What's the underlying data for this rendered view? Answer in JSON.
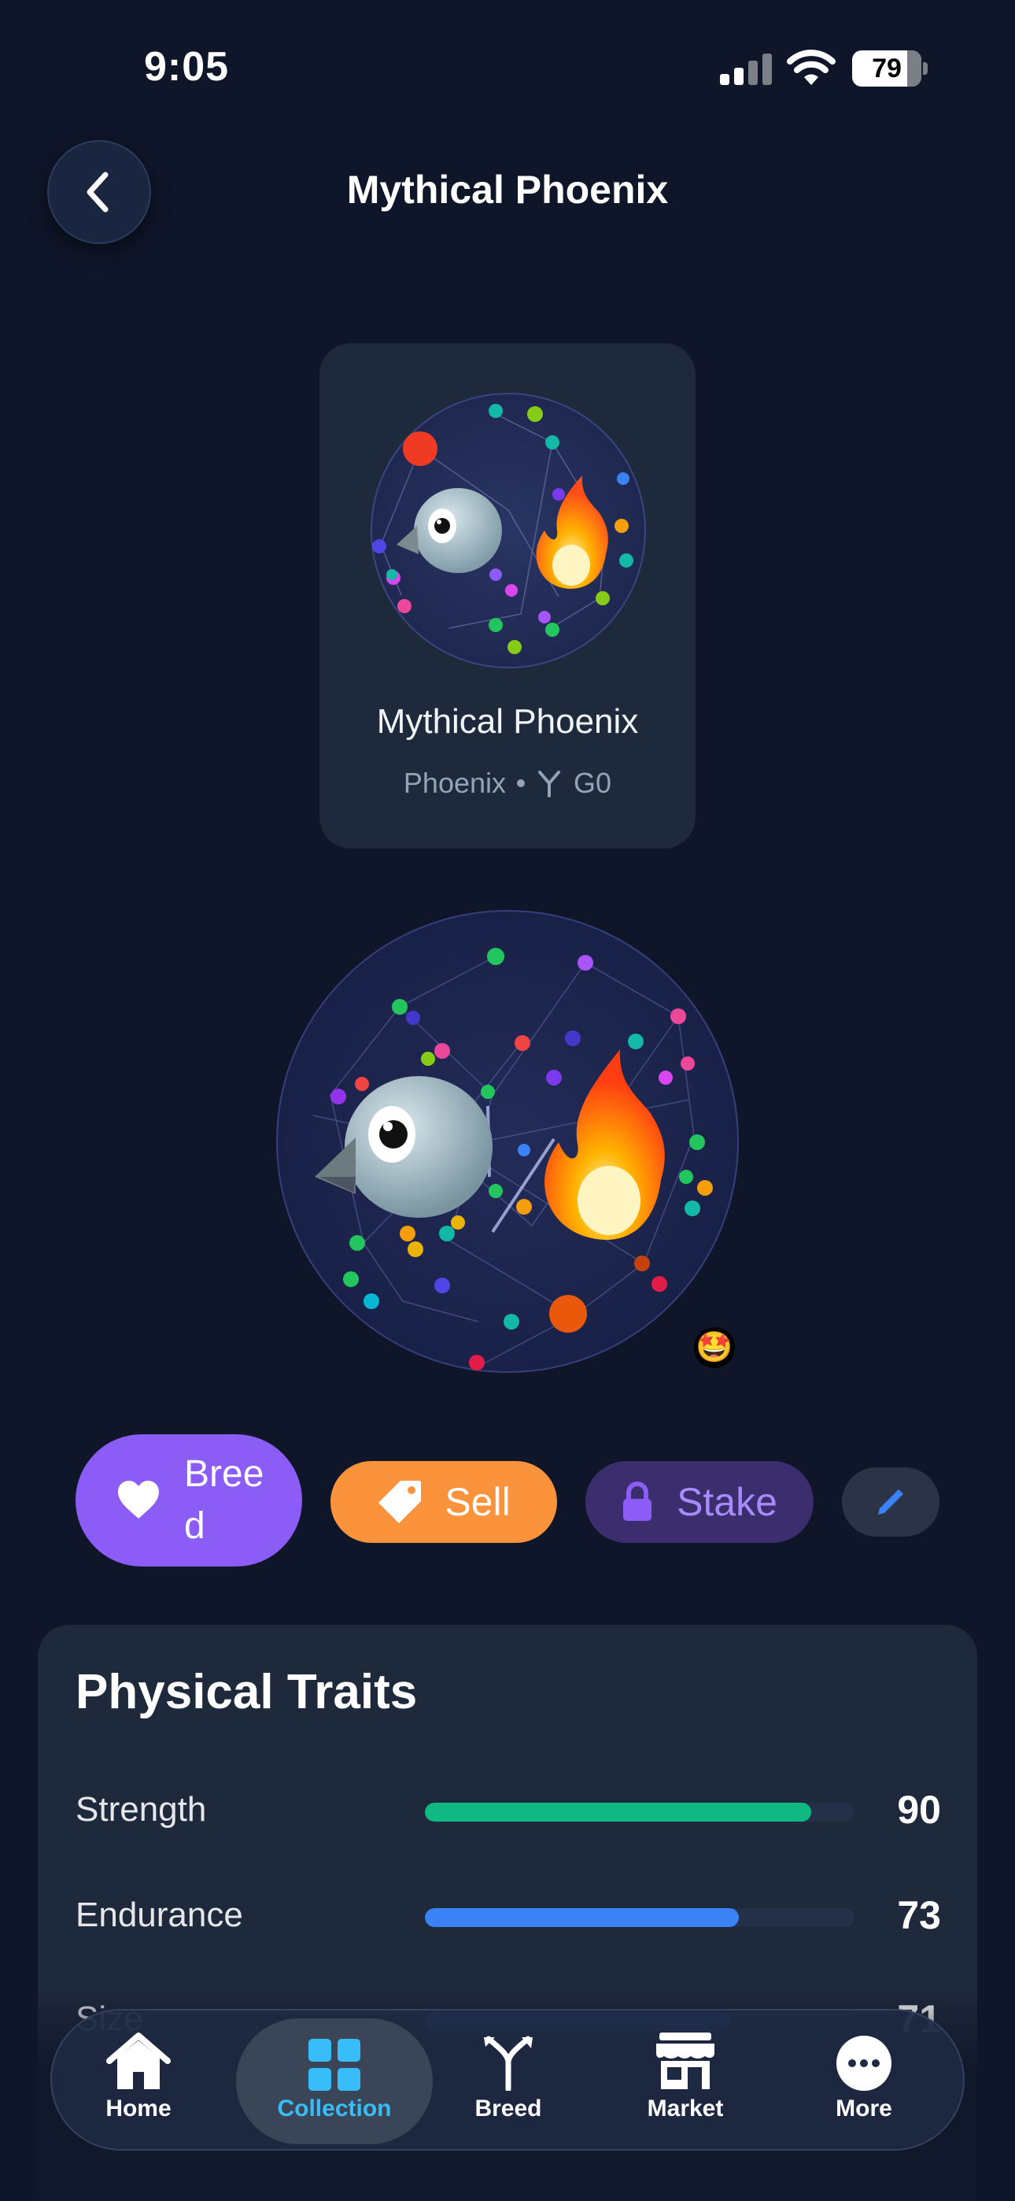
{
  "status_bar": {
    "time": "9:05",
    "battery": "79"
  },
  "header": {
    "title": "Mythical Phoenix"
  },
  "card": {
    "name": "Mythical Phoenix",
    "species": "Phoenix",
    "generation": "G0"
  },
  "mood_emoji": "🤩",
  "actions": {
    "breed": "Breed",
    "sell": "Sell",
    "stake": "Stake"
  },
  "traits": {
    "title": "Physical Traits",
    "items": [
      {
        "name": "Strength",
        "value": "90",
        "level": 0.9,
        "color": "#10b981"
      },
      {
        "name": "Endurance",
        "value": "73",
        "level": 0.73,
        "color": "#3b82f6"
      },
      {
        "name": "Size",
        "value": "71",
        "level": 0.71,
        "color": "#3b82f6"
      }
    ]
  },
  "tabbar": {
    "items": [
      {
        "label": "Home",
        "icon": "home-icon"
      },
      {
        "label": "Collection",
        "icon": "grid-icon",
        "active": true
      },
      {
        "label": "Breed",
        "icon": "branch-icon"
      },
      {
        "label": "Market",
        "icon": "store-icon"
      },
      {
        "label": "More",
        "icon": "more-icon"
      }
    ]
  },
  "colors": {
    "background": "#0f1629",
    "breed": "#8b5cf6",
    "sell": "#fb923c",
    "stake_bg": "#3b2d6e",
    "stake_text": "#a78bfa",
    "active_tab": "#38bdf8"
  }
}
